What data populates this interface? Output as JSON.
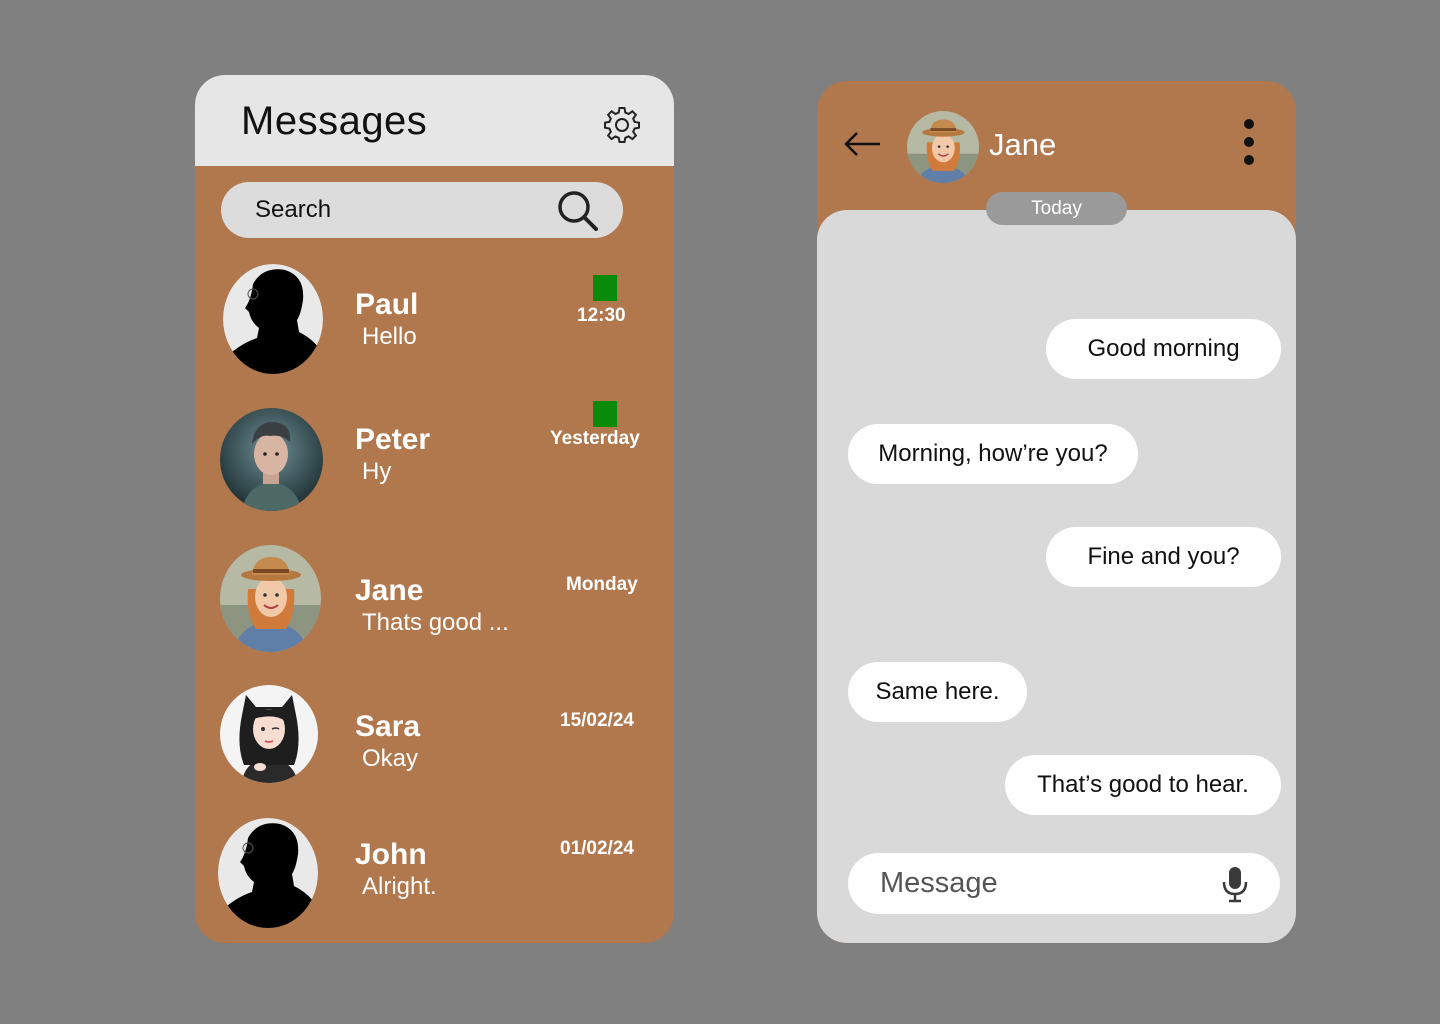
{
  "list": {
    "title": "Messages",
    "settings_icon": "gear-icon",
    "search": {
      "label": "Search",
      "icon": "search-icon"
    },
    "chats": [
      {
        "name": "Paul",
        "preview": "Hello",
        "time": "12:30",
        "unread": true,
        "avatar": "silhouette"
      },
      {
        "name": "Peter",
        "preview": "Hy",
        "time": "Yesterday",
        "unread": true,
        "avatar": "boy"
      },
      {
        "name": "Jane",
        "preview": "Thats good ...",
        "time": "Monday",
        "unread": false,
        "avatar": "girl-hat"
      },
      {
        "name": "Sara",
        "preview": "Okay",
        "time": "15/02/24",
        "unread": false,
        "avatar": "anime-girl"
      },
      {
        "name": "John",
        "preview": "Alright.",
        "time": "01/02/24",
        "unread": false,
        "avatar": "silhouette"
      }
    ]
  },
  "chat": {
    "contact": "Jane",
    "date_label": "Today",
    "messages": [
      {
        "text": "Good morning",
        "side": "right"
      },
      {
        "text": "Morning, how’re you?",
        "side": "left"
      },
      {
        "text": "Fine and you?",
        "side": "right"
      },
      {
        "text": "Same here.",
        "side": "left"
      },
      {
        "text": "That’s good to hear.",
        "side": "right"
      }
    ],
    "composer": {
      "placeholder": "Message",
      "mic_icon": "microphone-icon"
    }
  },
  "colors": {
    "background": "#808080",
    "panel": "#b1774d",
    "header": "#e6e6e6",
    "chat_surface": "#d9d9d9",
    "unread_indicator": "#0a8a0a"
  }
}
